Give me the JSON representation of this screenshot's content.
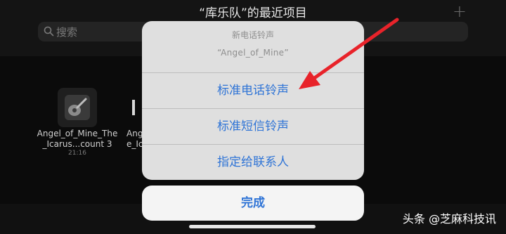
{
  "header": {
    "title": "“库乐队”的最近项目",
    "add_icon": "plus-icon"
  },
  "search": {
    "placeholder": "搜索",
    "icon": "search-icon"
  },
  "projects": [
    {
      "name_line1": "Angel_of_Mine_The",
      "name_line2": "_Icarus...count 3",
      "time": "21:16",
      "icon": "guitar-icon"
    },
    {
      "name_line1": "Angel",
      "name_line2": "e_Ic",
      "icon": "keyboard-icon"
    }
  ],
  "action_sheet": {
    "title": "新电话铃声",
    "message": "“Angel_of_Mine”",
    "actions": [
      "标准电话铃声",
      "标准短信铃声",
      "指定给联系人"
    ],
    "cancel": "完成",
    "accent_color": "#2f74d6"
  },
  "annotation": {
    "arrow_color": "#e8232a"
  },
  "watermark": "头条 @芝麻科技讯"
}
